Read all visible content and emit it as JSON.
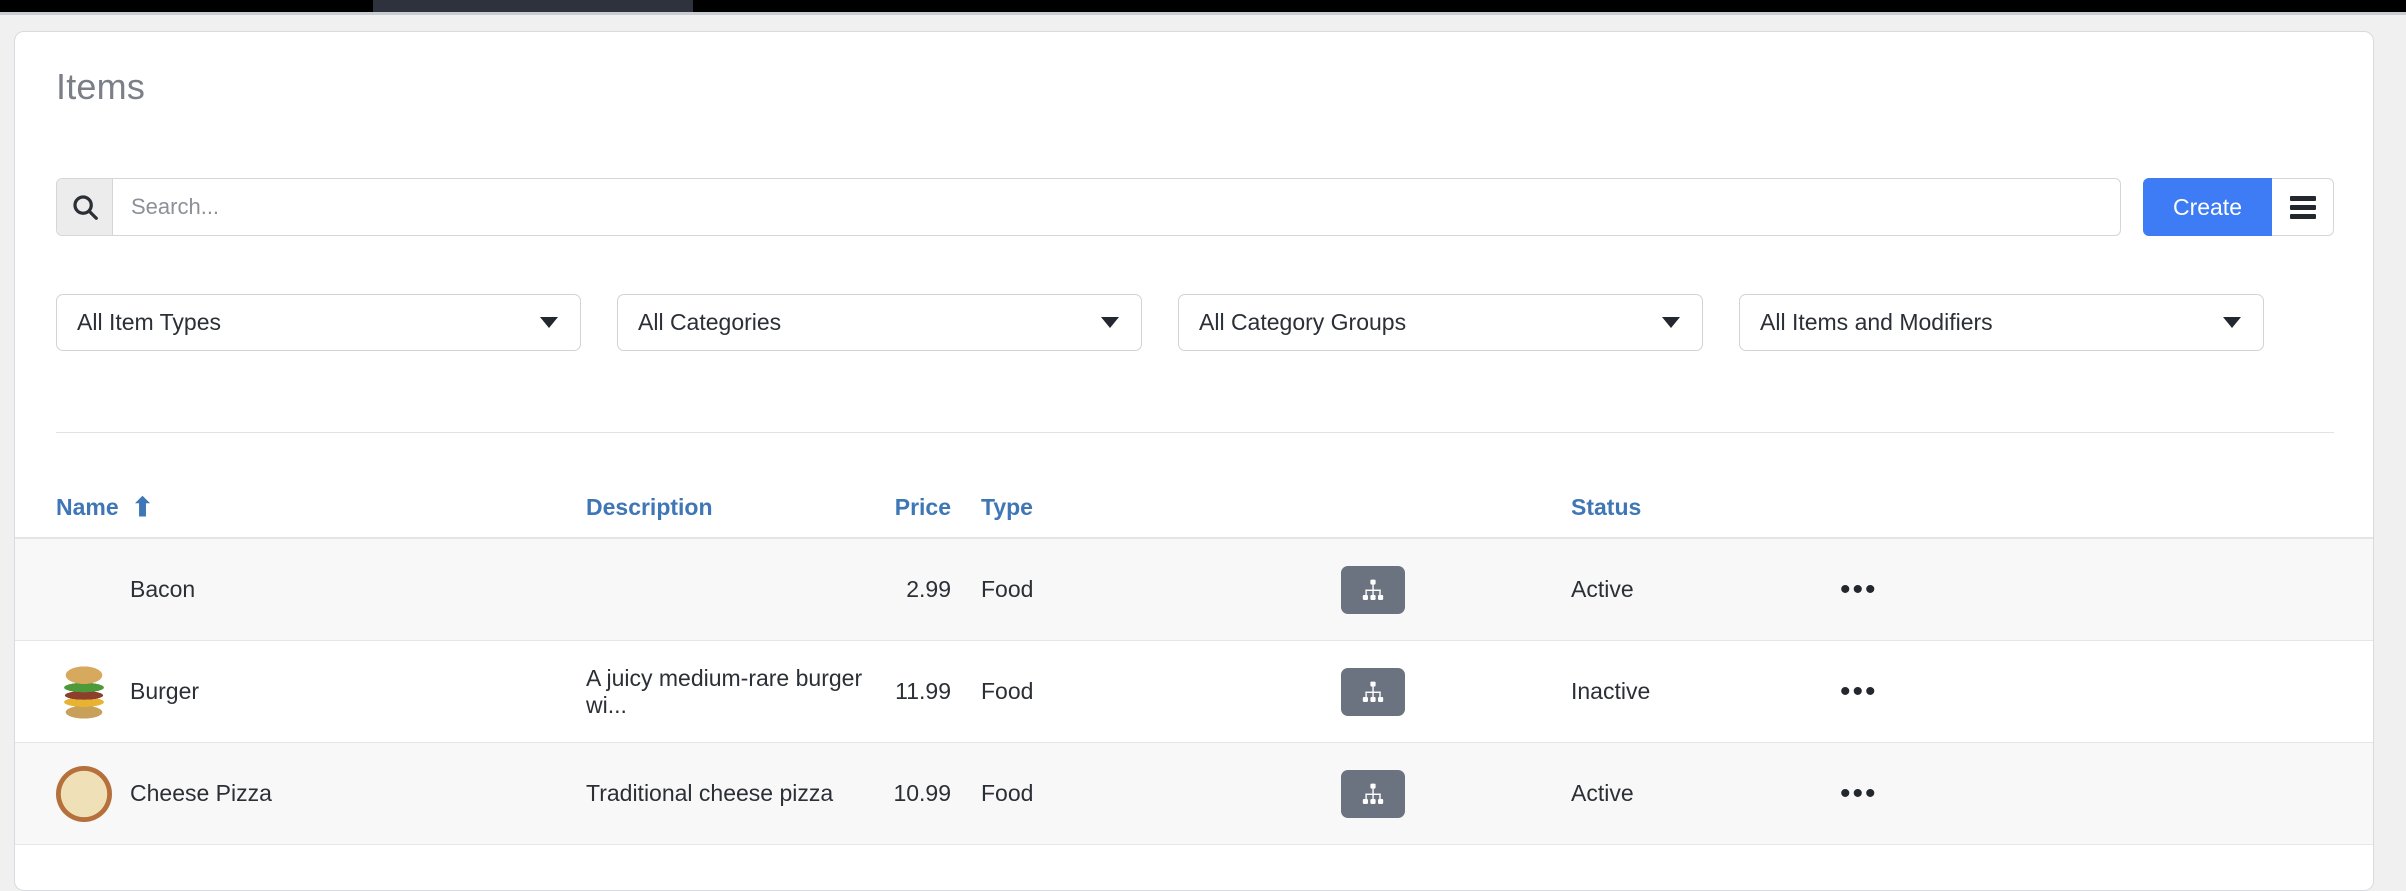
{
  "window": {
    "chrome_visible": true
  },
  "header": {
    "title": "Items"
  },
  "search": {
    "icon": "search-icon",
    "value": "",
    "placeholder": "Search..."
  },
  "toolbar": {
    "create_label": "Create",
    "menu_icon": "hamburger-menu-icon"
  },
  "filters": [
    {
      "label": "All Item Types",
      "icon": "chevron-down-icon"
    },
    {
      "label": "All Categories",
      "icon": "chevron-down-icon"
    },
    {
      "label": "All Category Groups",
      "icon": "chevron-down-icon"
    },
    {
      "label": "All Items and Modifiers",
      "icon": "chevron-down-icon"
    }
  ],
  "table": {
    "columns": [
      {
        "key": "name",
        "label": "Name",
        "sorted": true,
        "sort_icon": "arrow-up-icon",
        "sort_direction": "asc"
      },
      {
        "key": "description",
        "label": "Description",
        "sorted": false
      },
      {
        "key": "price",
        "label": "Price",
        "sorted": false
      },
      {
        "key": "type",
        "label": "Type",
        "sorted": false
      },
      {
        "key": "modifiers",
        "label": "",
        "sorted": false
      },
      {
        "key": "status",
        "label": "Status",
        "sorted": false
      },
      {
        "key": "actions",
        "label": "",
        "sorted": false
      }
    ],
    "sort_arrow": "⬆",
    "more_label": "•••",
    "rows": [
      {
        "name": "Bacon",
        "description": "",
        "price": "2.99",
        "type": "Food",
        "status": "Active",
        "has_thumbnail": false,
        "thumbnail": "",
        "modifier_icon": "sitemap-icon",
        "actions_icon": "ellipsis-icon"
      },
      {
        "name": "Burger",
        "description": "A juicy medium-rare burger wi...",
        "price": "11.99",
        "type": "Food",
        "status": "Inactive",
        "has_thumbnail": true,
        "thumbnail": "burger-photo",
        "modifier_icon": "sitemap-icon",
        "actions_icon": "ellipsis-icon"
      },
      {
        "name": "Cheese Pizza",
        "description": "Traditional cheese pizza",
        "price": "10.99",
        "type": "Food",
        "status": "Active",
        "has_thumbnail": true,
        "thumbnail": "cheese-pizza-photo",
        "modifier_icon": "sitemap-icon",
        "actions_icon": "ellipsis-icon"
      }
    ]
  },
  "colors": {
    "accent_blue": "#3d7cf4",
    "header_link_blue": "#3f76b5",
    "title_gray": "#7b8087",
    "modifier_button_gray": "#6b7280",
    "row_shaded": "#f8f8f8",
    "page_background": "#f0f0f0",
    "card_border": "#d7dbdf"
  }
}
